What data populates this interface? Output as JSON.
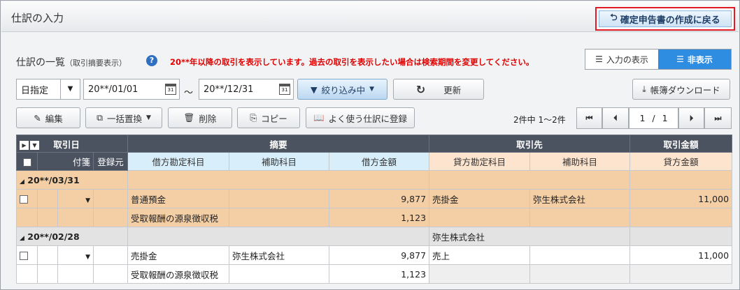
{
  "window": {
    "title": "仕訳の入力",
    "back_button": "確定申告書の作成に戻る"
  },
  "list": {
    "title": "仕訳の一覧",
    "subtitle": "（取引摘要表示）",
    "notice": "20**年以降の取引を表示しています。過去の取引を表示したい場合は検索期間を変更してください。",
    "toggle": {
      "show_input": "入力の表示",
      "hide": "非表示"
    }
  },
  "filter": {
    "date_mode": "日指定",
    "date_from": "20**/01/01",
    "date_to": "20**/12/31",
    "tilde": "～",
    "narrow": "絞り込み中",
    "refresh": "更新",
    "download": "帳簿ダウンロード"
  },
  "toolbar": {
    "edit": "編集",
    "bulk_replace": "一括置換",
    "delete": "削除",
    "copy": "コピー",
    "register_favorite": "よく使う仕訳に登録"
  },
  "pager": {
    "info": "2件中 1～2件",
    "page": "1",
    "sep": "/",
    "total": "1"
  },
  "table": {
    "header1": {
      "date": "取引日",
      "summary": "摘要",
      "partner": "取引先",
      "amount": "取引金額"
    },
    "header2": {
      "tag": "付箋",
      "registrar": "登録元",
      "debit_account": "借方勘定科目",
      "debit_sub": "補助科目",
      "debit_amount": "借方金額",
      "credit_account": "貸方勘定科目",
      "credit_sub": "補助科目",
      "credit_amount": "貸方金額"
    },
    "groups": [
      {
        "date": "20**/03/31",
        "partner": "",
        "rows": [
          {
            "debit_account": "普通預金",
            "debit_sub": "",
            "debit_amount": "9,877",
            "credit_account": "売掛金",
            "credit_sub": "弥生株式会社",
            "credit_amount": "11,000"
          },
          {
            "debit_account": "受取報酬の源泉徴収税",
            "debit_sub": "",
            "debit_amount": "1,123",
            "credit_account": "",
            "credit_sub": "",
            "credit_amount": ""
          }
        ]
      },
      {
        "date": "20**/02/28",
        "partner": "弥生株式会社",
        "rows": [
          {
            "debit_account": "売掛金",
            "debit_sub": "弥生株式会社",
            "debit_amount": "9,877",
            "credit_account": "売上",
            "credit_sub": "",
            "credit_amount": "11,000"
          },
          {
            "debit_account": "受取報酬の源泉徴収税",
            "debit_sub": "",
            "debit_amount": "1,123",
            "credit_account": "",
            "credit_sub": "",
            "credit_amount": ""
          }
        ]
      }
    ]
  }
}
